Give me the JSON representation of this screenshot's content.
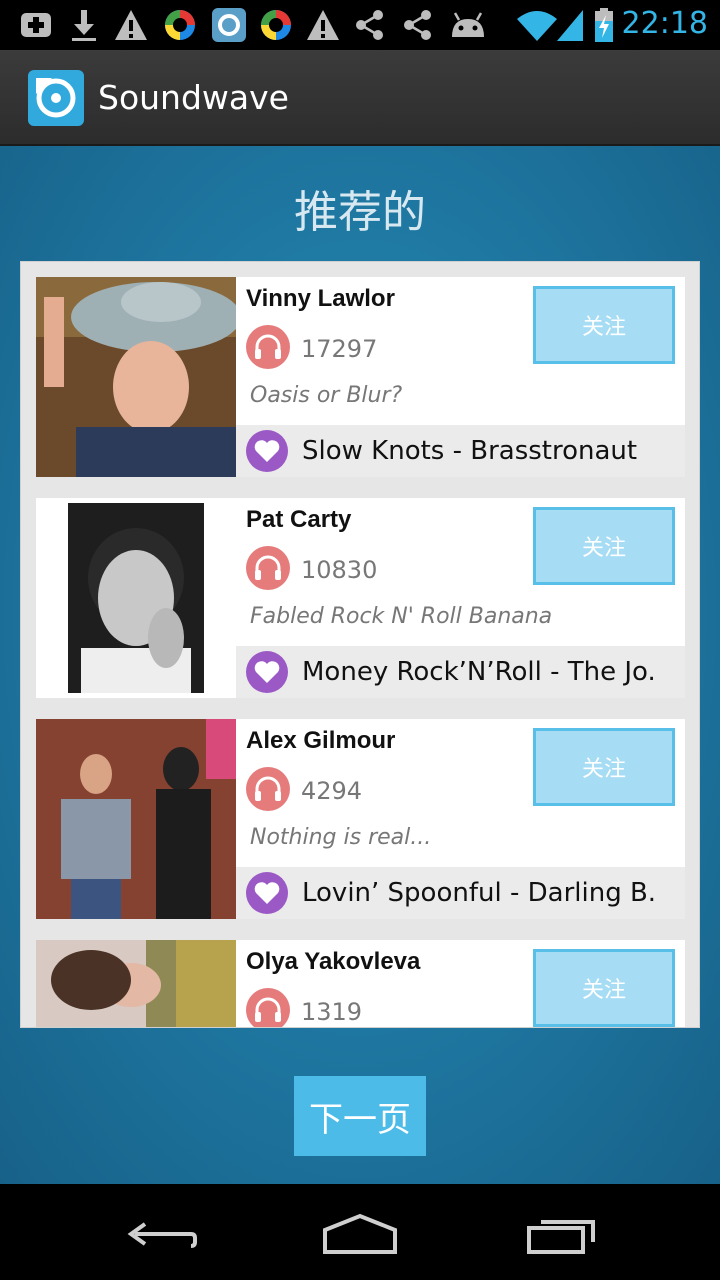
{
  "status_bar": {
    "time": "22:18",
    "icons": [
      "add-notification-icon",
      "download-icon",
      "warning-icon",
      "colorful-app-icon",
      "app-q-icon",
      "colorful-app-icon",
      "warning-icon",
      "share-icon",
      "share-icon",
      "android-icon",
      "wifi-icon",
      "signal-icon",
      "battery-charging-icon"
    ]
  },
  "action_bar": {
    "title": "Soundwave",
    "icon": "soundwave-logo-icon"
  },
  "page": {
    "heading": "推荐的",
    "next_button": "下一页"
  },
  "colors": {
    "accent": "#33b5e5",
    "follow_bg": "#a6dcf4",
    "headphone": "#e57b7b",
    "heart": "#9b59c6",
    "next_bg": "#4cbbe8"
  },
  "users": [
    {
      "name": "Vinny Lawlor",
      "plays": "17297",
      "bio": "Oasis or Blur?",
      "song": "Slow Knots - Brasstronaut",
      "follow_label": "关注"
    },
    {
      "name": "Pat Carty",
      "plays": "10830",
      "bio": "Fabled Rock N' Roll Banana",
      "song": "Money Rock’N’Roll - The Jo.",
      "follow_label": "关注"
    },
    {
      "name": "Alex Gilmour",
      "plays": "4294",
      "bio": "Nothing is real...",
      "song": "Lovin’ Spoonful - Darling B.",
      "follow_label": "关注"
    },
    {
      "name": "Olya Yakovleva",
      "plays": "1319",
      "bio": "",
      "song": "",
      "follow_label": "关注"
    }
  ],
  "nav": [
    "back-icon",
    "home-icon",
    "recent-apps-icon"
  ]
}
